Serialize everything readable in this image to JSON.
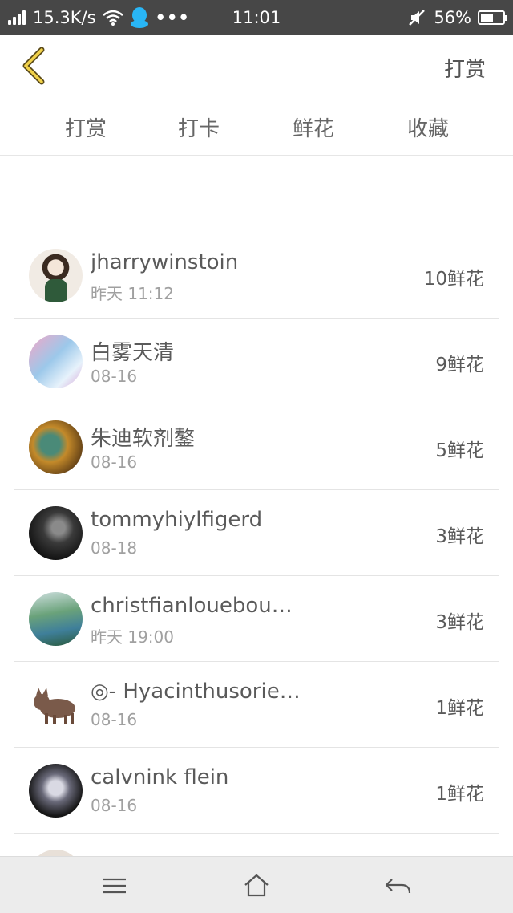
{
  "status_bar": {
    "speed": "15.3K/s",
    "time": "11:01",
    "battery": "56%",
    "battery_level": 0.56,
    "icons": [
      "signal-icon",
      "wifi-icon",
      "qq-icon",
      "more-dots-icon",
      "mute-icon",
      "battery-icon"
    ]
  },
  "header": {
    "back_icon": "chevron-left-icon",
    "action_label": "打赏"
  },
  "tabs": [
    {
      "label": "打赏",
      "active": false
    },
    {
      "label": "打卡",
      "active": false
    },
    {
      "label": "鲜花",
      "active": true
    },
    {
      "label": "收藏",
      "active": false
    }
  ],
  "colors": {
    "accent": "#f5a623",
    "status_bar": "#474747",
    "nav_bar": "#ececec"
  },
  "list": [
    {
      "name": "jharrywinstoin",
      "date": "昨天 11:12",
      "count": "10鲜花"
    },
    {
      "name": "白雾天清",
      "date": "08-16",
      "count": "9鲜花"
    },
    {
      "name": "朱迪软剂鏊",
      "date": "08-16",
      "count": "5鲜花"
    },
    {
      "name": "tommyhiylfigerd",
      "date": "08-18",
      "count": "3鲜花"
    },
    {
      "name": "christfianlouebou…",
      "date": "昨天 19:00",
      "count": "3鲜花"
    },
    {
      "name": "◎- Hyacinthusorie…",
      "date": "08-16",
      "count": "1鲜花"
    },
    {
      "name": "calvnink flein",
      "date": "08-16",
      "count": "1鲜花"
    }
  ],
  "navbar": {
    "icons": [
      "menu-icon",
      "home-icon",
      "back-icon"
    ]
  }
}
